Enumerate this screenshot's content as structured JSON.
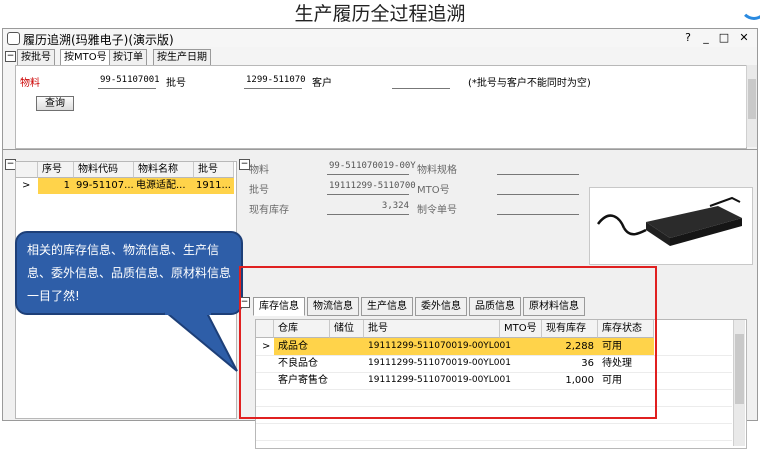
{
  "slide_title": "生产履历全过程追溯",
  "window": {
    "title": "履历追溯(玛雅电子)(演示版)",
    "controls": [
      "?",
      "_",
      "□",
      "✕"
    ]
  },
  "query": {
    "tabs": [
      "按批号",
      "按MTO号",
      "按订单",
      "按生产日期"
    ],
    "active_tab": "按MTO号",
    "material_label": "物料",
    "material_value": "99-51107001",
    "batch_label": "批号",
    "batch_value": "1299-511070",
    "customer_label": "客户",
    "customer_value": "",
    "note": "(*批号与客户不能同时为空)",
    "query_button": "查询"
  },
  "left_grid": {
    "headers": [
      "序号",
      "物料代码",
      "物料名称",
      "批号"
    ],
    "rows": [
      {
        "seq": "1",
        "code": "99-51107...",
        "name": "电源适配...",
        "batch": "1911..."
      }
    ]
  },
  "info": {
    "material_label": "物料",
    "material_value": "99-511070019-00Y",
    "spec_label": "物料规格",
    "batch_label": "批号",
    "batch_value": "19111299-5110700",
    "mto_label": "MTO号",
    "stock_label": "现有库存",
    "stock_value": "3,324",
    "order_label": "制令单号"
  },
  "callout": {
    "text": "相关的库存信息、物流信息、生产信息、委外信息、品质信息、原材料信息一目了然!"
  },
  "detail": {
    "tabs": [
      "库存信息",
      "物流信息",
      "生产信息",
      "委外信息",
      "品质信息",
      "原材料信息"
    ],
    "active_tab": "库存信息",
    "headers": [
      "仓库",
      "储位",
      "批号",
      "MTO号",
      "现有库存",
      "库存状态"
    ],
    "rows": [
      {
        "warehouse": "成品仓",
        "location": "",
        "batch": "19111299-511070019-00YL001",
        "mto": "",
        "stock": "2,288",
        "status": "可用"
      },
      {
        "warehouse": "不良品仓",
        "location": "",
        "batch": "19111299-511070019-00YL001",
        "mto": "",
        "stock": "36",
        "status": "待处理"
      },
      {
        "warehouse": "客户寄售仓",
        "location": "",
        "batch": "19111299-511070019-00YL001",
        "mto": "",
        "stock": "1,000",
        "status": "可用"
      }
    ]
  },
  "colors": {
    "selected_row": "#ffd34a",
    "callout_fill": "#2e5ea8",
    "highlight_border": "#e02020",
    "material_label": "#cc0000"
  },
  "icons": [
    "app-icon",
    "collapse-icon",
    "row-pointer-icon",
    "product-photo"
  ]
}
